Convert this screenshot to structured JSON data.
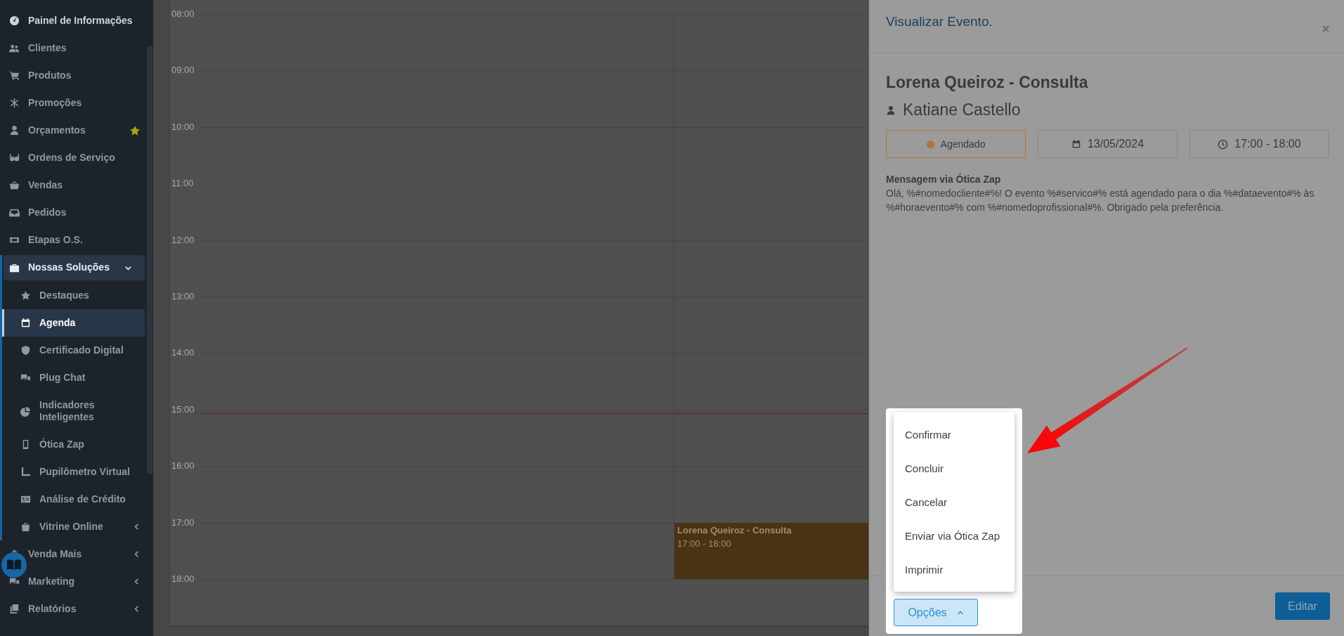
{
  "sidebar": {
    "items": [
      {
        "label": "Painel de Informações",
        "selected": true,
        "starred": false
      },
      {
        "label": "Clientes",
        "selected": false,
        "starred": false
      },
      {
        "label": "Produtos",
        "selected": false,
        "starred": false
      },
      {
        "label": "Promoções",
        "selected": false,
        "starred": false
      },
      {
        "label": "Orçamentos",
        "selected": false,
        "starred": true
      },
      {
        "label": "Ordens de Serviço",
        "selected": false,
        "starred": false
      },
      {
        "label": "Vendas",
        "selected": false,
        "starred": false
      },
      {
        "label": "Pedidos",
        "selected": false,
        "starred": false
      },
      {
        "label": "Etapas O.S.",
        "selected": false,
        "starred": false
      },
      {
        "label": "Nossas Soluções",
        "selected": true,
        "starred": false,
        "expanded": true,
        "children": [
          {
            "label": "Destaques",
            "selected": false
          },
          {
            "label": "Agenda",
            "selected": true
          },
          {
            "label": "Certificado Digital",
            "selected": false
          },
          {
            "label": "Plug Chat",
            "selected": false
          },
          {
            "label": "Indicadores Inteligentes",
            "selected": false
          },
          {
            "label": "Ótica Zap",
            "selected": false
          },
          {
            "label": "Pupilômetro Virtual",
            "selected": false
          },
          {
            "label": "Análise de Crédito",
            "selected": false
          },
          {
            "label": "Vitrine Online",
            "selected": false,
            "expanded": false
          }
        ]
      },
      {
        "label": "Venda Mais",
        "selected": false,
        "starred": false,
        "expanded": false
      },
      {
        "label": "Marketing",
        "selected": false,
        "starred": false,
        "expanded": false
      },
      {
        "label": "Relatórios",
        "selected": false,
        "starred": false,
        "expanded": false
      }
    ]
  },
  "calendar": {
    "hours": [
      "08:00",
      "09:00",
      "10:00",
      "11:00",
      "12:00",
      "13:00",
      "14:00",
      "15:00",
      "16:00",
      "17:00",
      "18:00"
    ],
    "event": {
      "title": "Lorena Queiroz - Consulta",
      "time": "17:00 - 18:00"
    }
  },
  "panel": {
    "title": "Visualizar Evento.",
    "event_title": "Lorena Queiroz - Consulta",
    "professional": "Katiane Castello",
    "status": {
      "label": "Agendado",
      "color": "#b57232"
    },
    "date": "13/05/2024",
    "time": "17:00 - 18:00",
    "message": {
      "heading": "Mensagem via Ótica Zap",
      "text": "Olá, %#nomedocliente#%! O evento %#servico#% está agendado para o dia %#dataevento#% às %#horaevento#% com %#nomedoprofissional#%. Obrigado pela preferência."
    },
    "menu": [
      "Confirmar",
      "Concluir",
      "Cancelar",
      "Enviar via Ótica Zap",
      "Imprimir"
    ],
    "options_button": {
      "label": "Opções",
      "expanded": true
    },
    "edit_button": "Editar"
  }
}
